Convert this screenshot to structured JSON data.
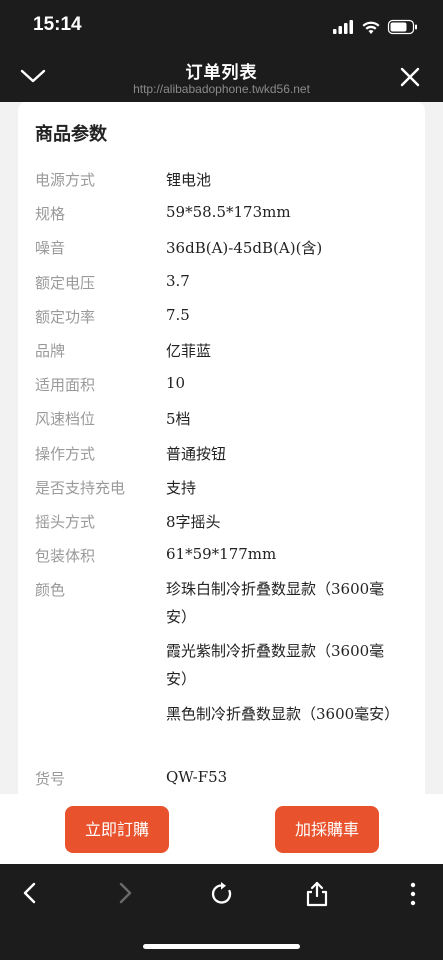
{
  "status": {
    "time": "15:14",
    "icons": [
      "cellular-signal-icon",
      "wifi-icon",
      "battery-icon"
    ]
  },
  "nav": {
    "title": "订单列表",
    "url": "http://alibabadophone.twkd56.net"
  },
  "card": {
    "title": "商品参数",
    "params": [
      {
        "label": "电源方式",
        "value": "锂电池"
      },
      {
        "label": "规格",
        "value": "59*58.5*173mm"
      },
      {
        "label": "噪音",
        "value": "36dB(A)-45dB(A)(含)"
      },
      {
        "label": "额定电压",
        "value": "3.7"
      },
      {
        "label": "额定功率",
        "value": "7.5"
      },
      {
        "label": "品牌",
        "value": "亿菲蓝"
      },
      {
        "label": "适用面积",
        "value": "10"
      },
      {
        "label": "风速档位",
        "value": "5档"
      },
      {
        "label": "操作方式",
        "value": "普通按钮"
      },
      {
        "label": "是否支持充电",
        "value": "支持"
      },
      {
        "label": "摇头方式",
        "value": "8字摇头"
      },
      {
        "label": "包装体积",
        "value": "61*59*177mm"
      }
    ],
    "color_label": "颜色",
    "color_options": [
      "珍珠白制冷折叠数显款（3600毫安）",
      "霞光紫制冷折叠数显款（3600毫安）",
      "黑色制冷折叠数显款（3600毫安）"
    ],
    "sku_label": "货号",
    "sku_value": "QW-F53"
  },
  "actions": {
    "buy_now": "立即訂購",
    "add_to_cart": "加採購車"
  },
  "colors": {
    "accent": "#e8522c",
    "chrome": "#1c1c1c",
    "label_gray": "#9a9a9a"
  }
}
